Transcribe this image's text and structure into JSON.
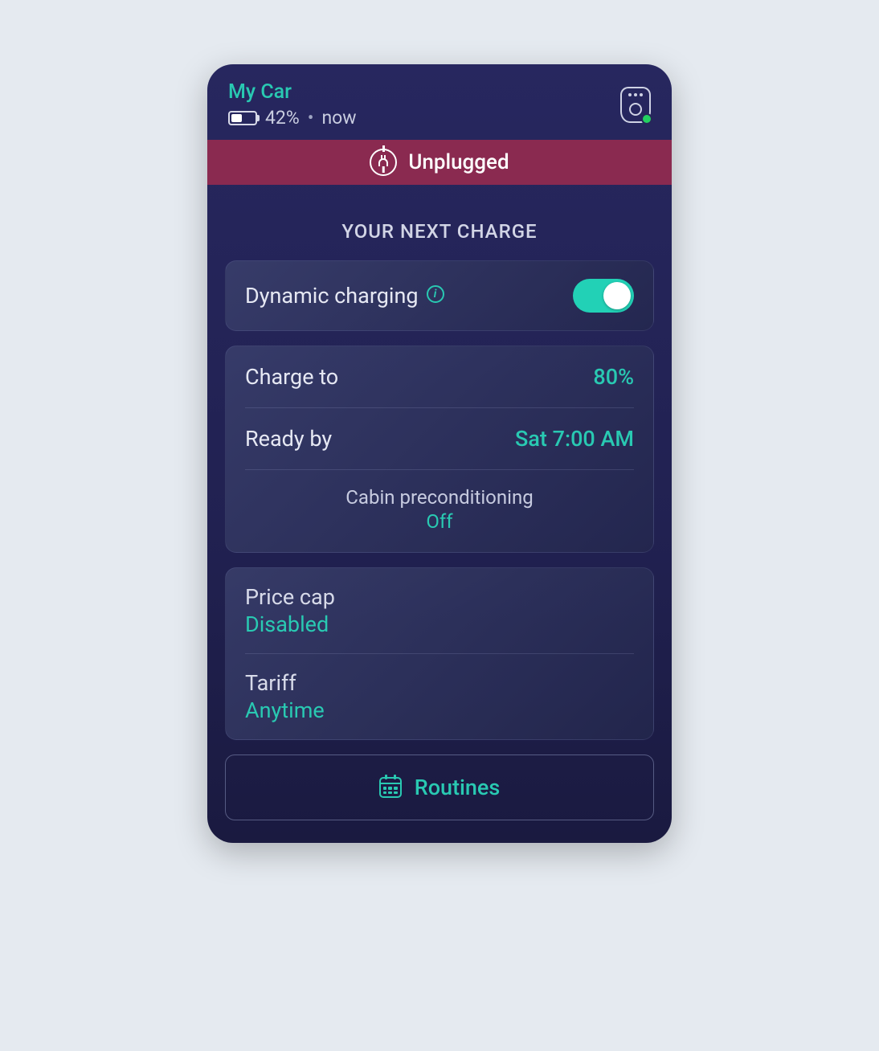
{
  "header": {
    "car_name": "My Car",
    "battery_percent": "42%",
    "separator": "•",
    "updated": "now"
  },
  "status": {
    "label": "Unplugged"
  },
  "next_charge_title": "YOUR NEXT CHARGE",
  "dynamic_charging": {
    "label": "Dynamic charging",
    "enabled": true
  },
  "charge_settings": {
    "charge_to_label": "Charge to",
    "charge_to_value": "80%",
    "ready_by_label": "Ready by",
    "ready_by_value": "Sat 7:00 AM",
    "cabin_label": "Cabin preconditioning",
    "cabin_value": "Off"
  },
  "pricing": {
    "price_cap_label": "Price cap",
    "price_cap_value": "Disabled",
    "tariff_label": "Tariff",
    "tariff_value": "Anytime"
  },
  "routines_label": "Routines"
}
